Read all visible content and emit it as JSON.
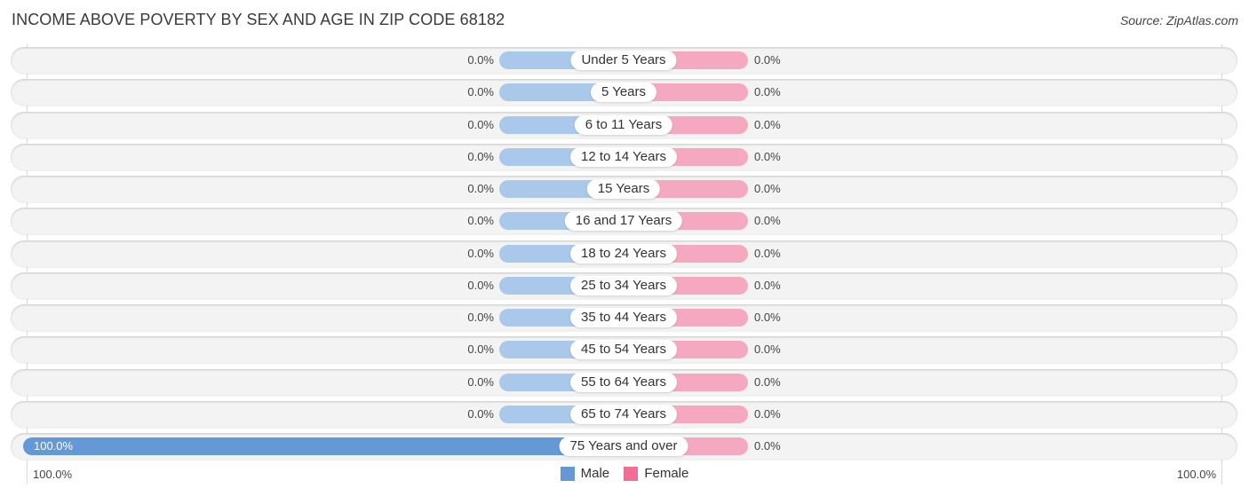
{
  "title": "INCOME ABOVE POVERTY BY SEX AND AGE IN ZIP CODE 68182",
  "source": "Source: ZipAtlas.com",
  "colors": {
    "male": "#6499d6",
    "male_stub": "#a9c8ea",
    "female": "#f06d96",
    "female_stub": "#f5a9c0"
  },
  "axis": {
    "left_label": "100.0%",
    "right_label": "100.0%"
  },
  "legend": [
    {
      "label": "Male",
      "color": "#6499d6"
    },
    {
      "label": "Female",
      "color": "#f06d96"
    }
  ],
  "chart_data": {
    "type": "bar",
    "orientation": "horizontal-diverging",
    "title": "INCOME ABOVE POVERTY BY SEX AND AGE IN ZIP CODE 68182",
    "categories": [
      "Under 5 Years",
      "5 Years",
      "6 to 11 Years",
      "12 to 14 Years",
      "15 Years",
      "16 and 17 Years",
      "18 to 24 Years",
      "25 to 34 Years",
      "35 to 44 Years",
      "45 to 54 Years",
      "55 to 64 Years",
      "65 to 74 Years",
      "75 Years and over"
    ],
    "series": [
      {
        "name": "Male",
        "values": [
          0,
          0,
          0,
          0,
          0,
          0,
          0,
          0,
          0,
          0,
          0,
          0,
          100.0
        ],
        "labels": [
          "0.0%",
          "0.0%",
          "0.0%",
          "0.0%",
          "0.0%",
          "0.0%",
          "0.0%",
          "0.0%",
          "0.0%",
          "0.0%",
          "0.0%",
          "0.0%",
          "100.0%"
        ]
      },
      {
        "name": "Female",
        "values": [
          0,
          0,
          0,
          0,
          0,
          0,
          0,
          0,
          0,
          0,
          0,
          0,
          0
        ],
        "labels": [
          "0.0%",
          "0.0%",
          "0.0%",
          "0.0%",
          "0.0%",
          "0.0%",
          "0.0%",
          "0.0%",
          "0.0%",
          "0.0%",
          "0.0%",
          "0.0%",
          "0.0%"
        ]
      }
    ],
    "xlim": [
      -100,
      100
    ],
    "xlabel": "",
    "ylabel": "",
    "tick_labels": [
      "100.0%",
      "100.0%"
    ],
    "legend_position": "bottom-center",
    "grid": false
  }
}
